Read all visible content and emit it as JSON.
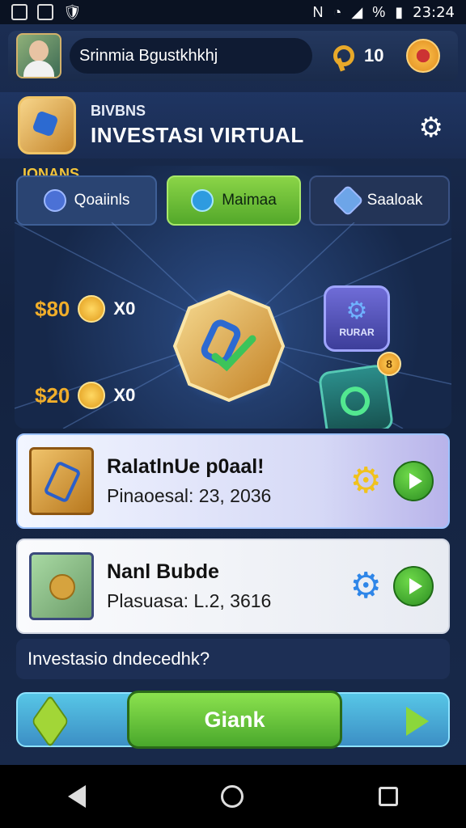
{
  "status": {
    "time": "23:24",
    "battery": "%"
  },
  "profile": {
    "name": "Srinmia Bgustkhkhj",
    "keys": "10"
  },
  "header": {
    "subtitle": "BIVBNS",
    "title": "INVESTASI VIRTUAL"
  },
  "game": {
    "note": "IONANS",
    "tabs": [
      {
        "label": "Qoaiinls",
        "icon": "check-badge-icon"
      },
      {
        "label": "Maimaa",
        "icon": "gear-icon"
      },
      {
        "label": "Saaloak",
        "icon": "rocket-icon"
      }
    ],
    "rewards": [
      {
        "amount": "$80",
        "multiplier": "X0"
      },
      {
        "amount": "$20",
        "multiplier": "X0"
      }
    ],
    "card_label": "RURAR",
    "badge_value": "8"
  },
  "items": [
    {
      "title": "RalatlnUe p0aal!",
      "subtitle": "Pinaoesal: 23, 2036"
    },
    {
      "title": "Nanl Bubde",
      "subtitle": "Plasuasa: L.2, 3616"
    }
  ],
  "question": "Investasio dndecedhk?",
  "bottom": {
    "button_label": "Giank"
  },
  "colors": {
    "accent_green": "#5ab833",
    "accent_blue": "#3c8fc5",
    "gold": "#f1ae2a"
  }
}
